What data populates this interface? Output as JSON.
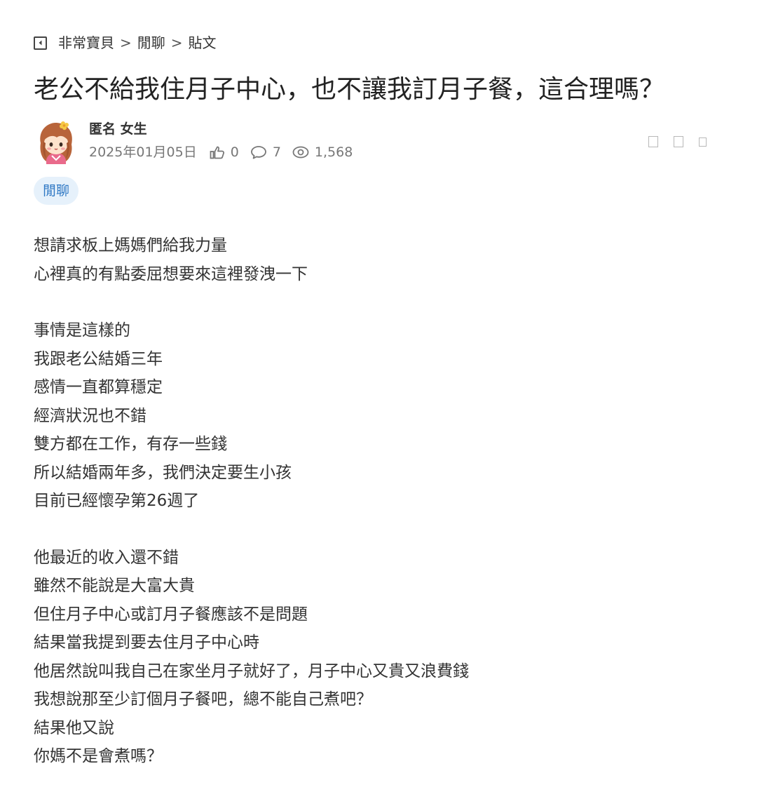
{
  "breadcrumb": {
    "board": "非常寶貝",
    "separator": ">",
    "category": "閒聊",
    "current": "貼文"
  },
  "post": {
    "title": "老公不給我住月子中心，也不讓我訂月子餐，這合理嗎？",
    "author": "匿名 女生",
    "date": "2025年01月05日",
    "likes": "0",
    "comments": "7",
    "views": "1,568",
    "tag": "閒聊"
  },
  "icons": {
    "back": "back-arrow-icon",
    "like": "thumbs-up-icon",
    "comment": "comment-bubble-icon",
    "view": "eye-icon"
  },
  "colors": {
    "tag_bg": "#e6f1fb",
    "tag_text": "#2f78c4",
    "meta_text": "#777777"
  },
  "body": {
    "paragraphs": [
      [
        "想請求板上媽媽們給我力量",
        "心裡真的有點委屈想要來這裡發洩一下"
      ],
      [
        "事情是這樣的",
        "我跟老公結婚三年",
        "感情一直都算穩定",
        "經濟狀況也不錯",
        "雙方都在工作，有存一些錢",
        "所以結婚兩年多，我們決定要生小孩",
        "目前已經懷孕第26週了"
      ],
      [
        "他最近的收入還不錯",
        "雖然不能說是大富大貴",
        "但住月子中心或訂月子餐應該不是問題",
        "結果當我提到要去住月子中心時",
        "他居然說叫我自己在家坐月子就好了，月子中心又貴又浪費錢",
        "我想說那至少訂個月子餐吧，總不能自己煮吧？",
        "結果他又說",
        "你媽不是會煮嗎？"
      ]
    ]
  }
}
